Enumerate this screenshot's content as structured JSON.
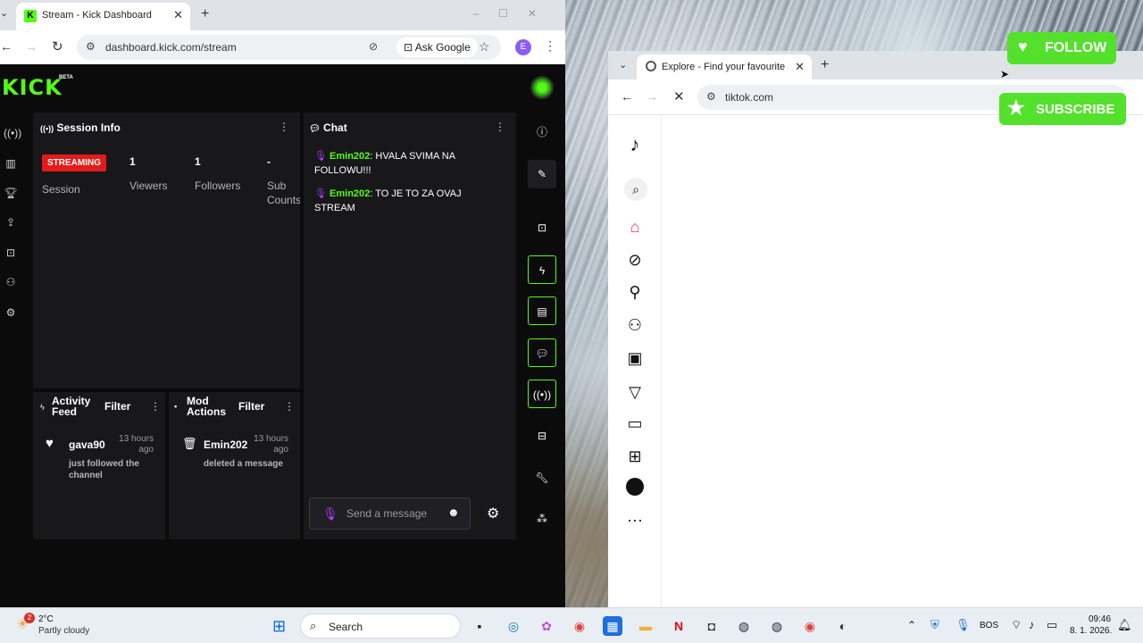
{
  "left_window": {
    "tab_title": "Stream - Kick Dashboard",
    "url": "dashboard.kick.com/stream",
    "ask_google": "Ask Google",
    "profile_initial": "E"
  },
  "kick": {
    "logo": "KICK",
    "beta": "BETA",
    "session": {
      "title": "Session Info",
      "badge": "STREAMING",
      "badge_label": "Session",
      "viewers_value": "1",
      "viewers_label": "Viewers",
      "followers_value": "1",
      "followers_label": "Followers",
      "subs_value": "-",
      "subs_label_1": "Sub",
      "subs_label_2": "Counts"
    },
    "chat": {
      "title": "Chat",
      "messages": [
        {
          "user": "Emin202",
          "text": ": HVALA SVIMA NA FOLLOWU!!!"
        },
        {
          "user": "Emin202",
          "text": ": TO JE TO ZA OVAJ STREAM"
        }
      ],
      "placeholder": "Send a message"
    },
    "activity": {
      "title_1": "Activity",
      "title_2": "Feed",
      "filter": "Filter",
      "item_user": "gava90",
      "item_time_1": "13 hours",
      "item_time_2": "ago",
      "item_text_1": "just followed the",
      "item_text_2": "channel"
    },
    "mod": {
      "title_1": "Mod",
      "title_2": "Actions",
      "filter": "Filter",
      "item_user": "Emin202",
      "item_time_1": "13 hours",
      "item_time_2": "ago",
      "item_text": "deleted a message"
    }
  },
  "right_window": {
    "tab_title": "Explore - Find your favourite vi",
    "url": "tiktok.com"
  },
  "overlay": {
    "follow": "FOLLOW",
    "subscribe": "SUBSCRIBE"
  },
  "taskbar": {
    "temp": "2°C",
    "weather": "Partly cloudy",
    "weather_badge": "2",
    "search": "Search",
    "lang": "BOS",
    "time": "09:46",
    "date": "8. 1. 2026."
  },
  "colors": {
    "kick_green": "#53fc18",
    "streaming_red": "#e31b1b",
    "tiktok_red": "#fe2c55"
  }
}
